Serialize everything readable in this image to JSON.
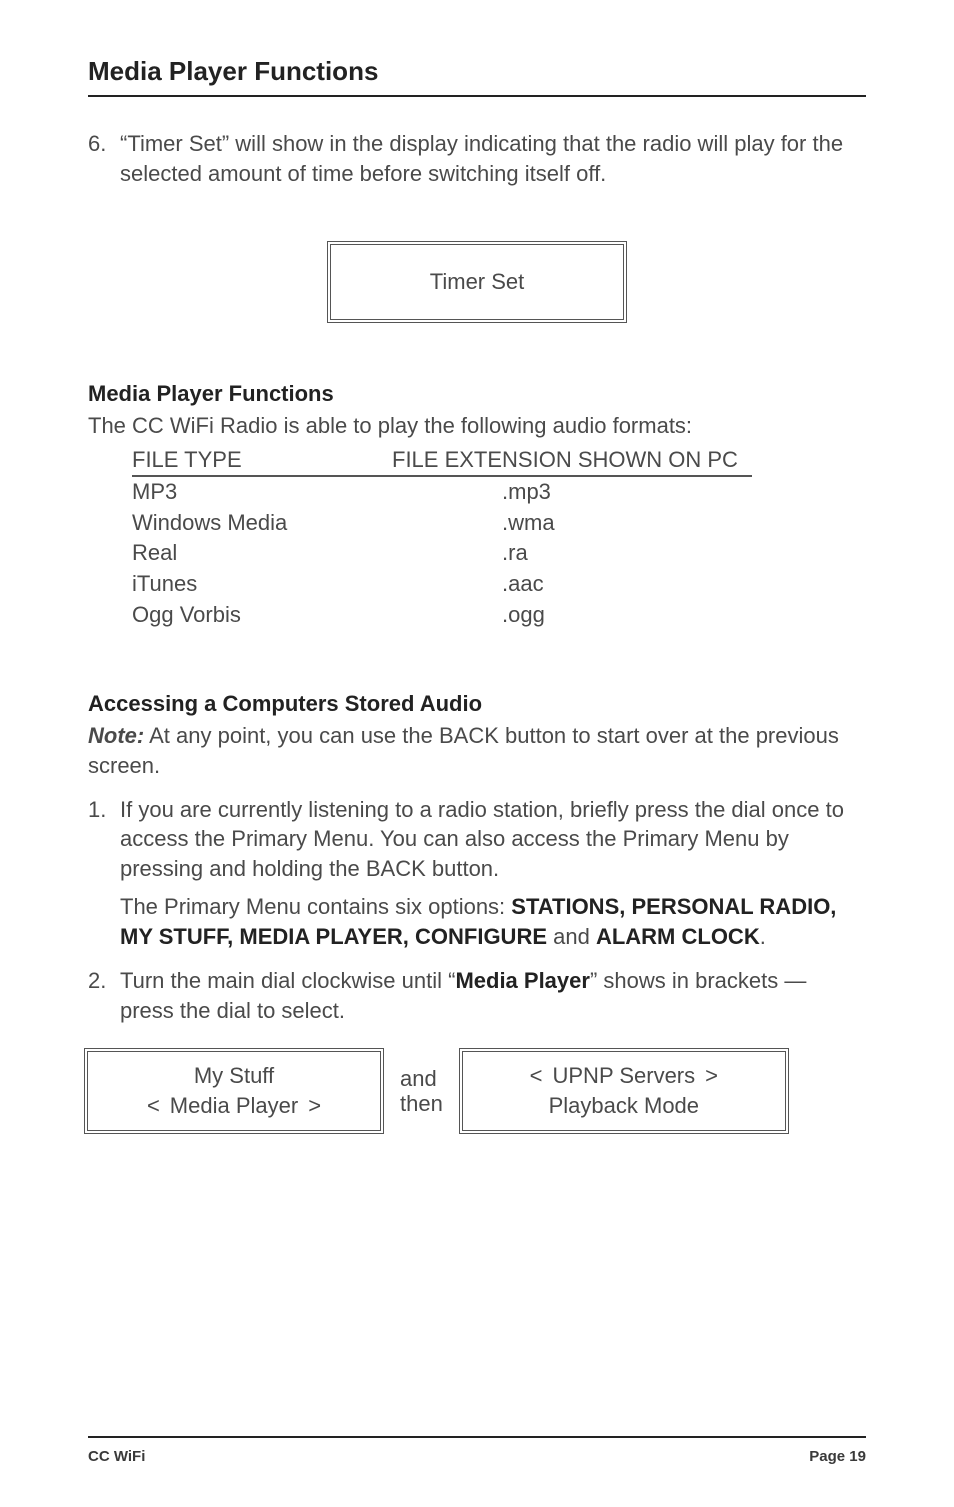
{
  "header": {
    "title": "Media Player Functions"
  },
  "timer_step": {
    "number": "6.",
    "text": "“Timer Set” will show in the display indicating that the radio will play for the selected amount of time before switching itself off."
  },
  "timer_display": "Timer Set",
  "section_media_player": {
    "heading": "Media Player Functions",
    "intro": "The CC WiFi Radio is able to play the following audio formats:",
    "table": {
      "col1_header": "FILE TYPE",
      "col2_header": "FILE EXTENSION SHOWN ON PC",
      "rows": [
        {
          "type": "MP3",
          "ext": ".mp3"
        },
        {
          "type": "Windows Media",
          "ext": ".wma"
        },
        {
          "type": "Real",
          "ext": ".ra"
        },
        {
          "type": "iTunes",
          "ext": ".aac"
        },
        {
          "type": "Ogg Vorbis",
          "ext": ".ogg"
        }
      ]
    }
  },
  "section_access": {
    "heading": "Accessing a Computers Stored Audio",
    "note_label": "Note:",
    "note_text": " At any point, you can use the BACK button to start over at the previous screen.",
    "steps": [
      {
        "number": "1.",
        "p1": "If you are currently listening to a radio station, briefly press the dial once to access the Primary Menu. You can also access the Primary Menu by pressing and holding the BACK button.",
        "p2_prefix": "The Primary Menu contains six options: ",
        "p2_bold1": "STATIONS, PERSONAL RADIO, MY STUFF, MEDIA PLAYER, CONFIGURE",
        "p2_mid": " and ",
        "p2_bold2": "ALARM CLOCK",
        "p2_suffix": "."
      },
      {
        "number": "2.",
        "p1_prefix": "Turn the main dial clockwise until “",
        "p1_bold": "Media Player",
        "p1_suffix": "” shows in brackets — press the dial to select."
      }
    ]
  },
  "screens": {
    "left": {
      "line1": "My Stuff",
      "line2": "Media Player",
      "lbracket": "<",
      "rbracket": ">"
    },
    "and_then_1": "and",
    "and_then_2": "then",
    "right": {
      "line1": "UPNP Servers",
      "line2": "Playback Mode",
      "lbracket": "<",
      "rbracket": ">"
    }
  },
  "footer": {
    "left": "CC WiFi",
    "right": "Page 19"
  }
}
